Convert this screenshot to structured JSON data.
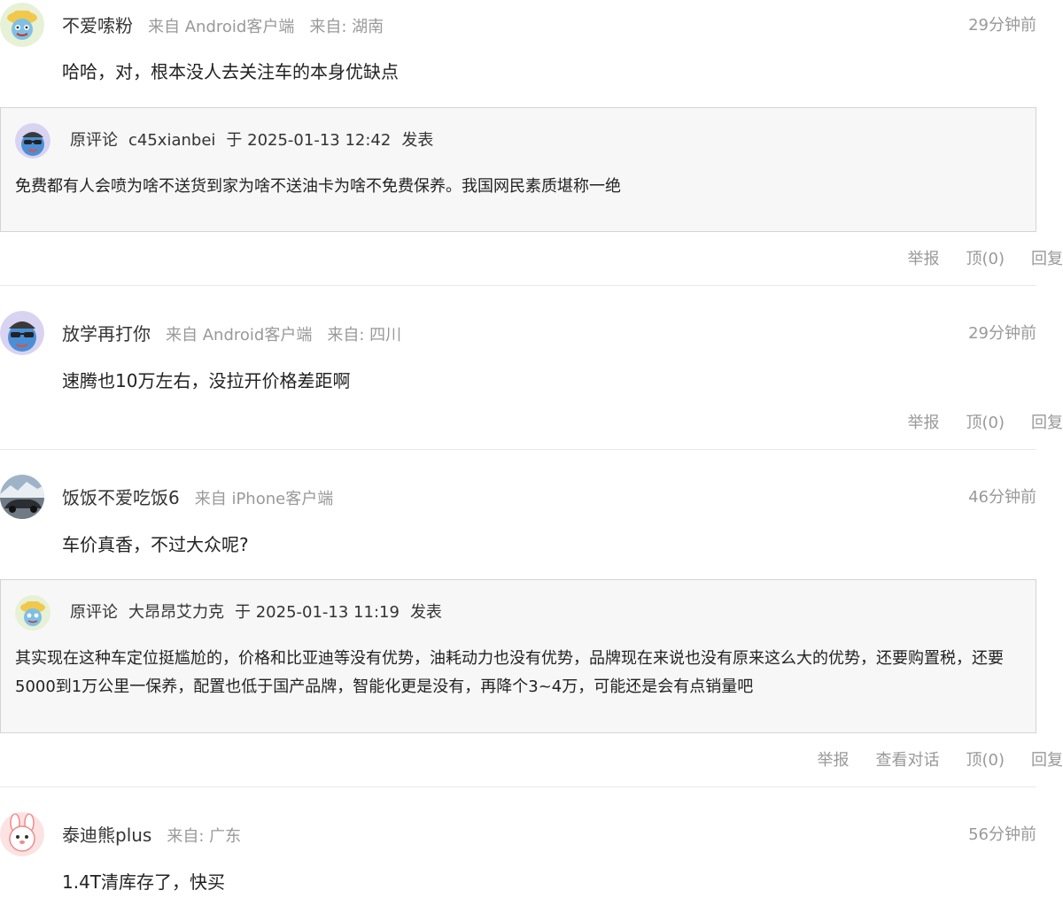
{
  "comments": [
    {
      "username": "不爱嗦粉",
      "source": "来自 Android客户端",
      "location": "来自: 湖南",
      "time": "29分钟前",
      "content": "哈哈，对，根本没人去关注车的本身优缺点",
      "quote": {
        "label": "原评论",
        "author": "c45xianbei",
        "datetime": "于 2025-01-13 12:42",
        "action": "发表",
        "text": "免费都有人会喷为啥不送货到家为啥不送油卡为啥不免费保养。我国网民素质堪称一绝"
      },
      "actions": [
        "举报",
        "顶(0)",
        "回复"
      ]
    },
    {
      "username": "放学再打你",
      "source": "来自 Android客户端",
      "location": "来自: 四川",
      "time": "29分钟前",
      "content": "速腾也10万左右，没拉开价格差距啊",
      "actions": [
        "举报",
        "顶(0)",
        "回复"
      ]
    },
    {
      "username": "饭饭不爱吃饭6",
      "source": "来自 iPhone客户端",
      "time": "46分钟前",
      "content": "车价真香，不过大众呢?",
      "quote": {
        "label": "原评论",
        "author": "大昂昂艾力克",
        "datetime": "于 2025-01-13 11:19",
        "action": "发表",
        "text": "其实现在这种车定位挺尴尬的，价格和比亚迪等没有优势，油耗动力也没有优势，品牌现在来说也没有原来这么大的优势，还要购置税，还要5000到1万公里一保养，配置也低于国产品牌，智能化更是没有，再降个3~4万，可能还是会有点销量吧"
      },
      "actions": [
        "举报",
        "查看对话",
        "顶(0)",
        "回复"
      ]
    },
    {
      "username": "泰迪熊plus",
      "location": "来自: 广东",
      "time": "56分钟前",
      "content": "1.4T清库存了，快买"
    }
  ],
  "colors": {
    "meta_gray": "#999999",
    "quote_bg": "#f7f7f7",
    "quote_border": "#d4d4d4",
    "divider": "#e8e8e8"
  },
  "icons": {
    "avatar_1": "cartoon-hat-avatar",
    "avatar_2": "cartoon-sunglasses-avatar",
    "avatar_3": "car-photo-avatar",
    "avatar_4": "cartoon-rabbit-avatar"
  }
}
